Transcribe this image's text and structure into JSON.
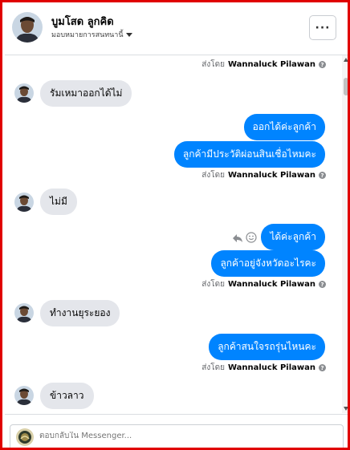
{
  "header": {
    "contact_name": "บูมโสด ลูกคิด",
    "subtitle": "มอบหมายการสนทนานี้",
    "more_label": "···"
  },
  "sender_name": "Wannaluck Pilawan",
  "sent_by_prefix": "ส่งโดย",
  "messages": {
    "in_1": "รัมเหมาออกได้ไม่",
    "out_1": "ออกได้ค่ะลูกค้า",
    "out_2": "ลูกค้ามีประวัติผ่อนสินเชื่อไหมคะ",
    "in_2": "ไม่มี",
    "out_3": "ได้ค่ะลูกค้า",
    "out_4": "ลูกค้าอยู่จังหวัดอะไรคะ",
    "in_3": "ทำงานยุระยอง",
    "out_5": "ลูกค้าสนใจรถรุ่นไหนคะ",
    "in_4": "ข้าวลาว"
  },
  "composer": {
    "placeholder": "ตอบกลับใน Messenger..."
  },
  "icons": {
    "info": "info-icon",
    "reply": "reply-icon",
    "emoji": "smiley-icon"
  },
  "colors": {
    "outgoing_bubble": "#0084ff",
    "incoming_bubble": "#e4e6eb",
    "frame_border": "#e00000"
  }
}
